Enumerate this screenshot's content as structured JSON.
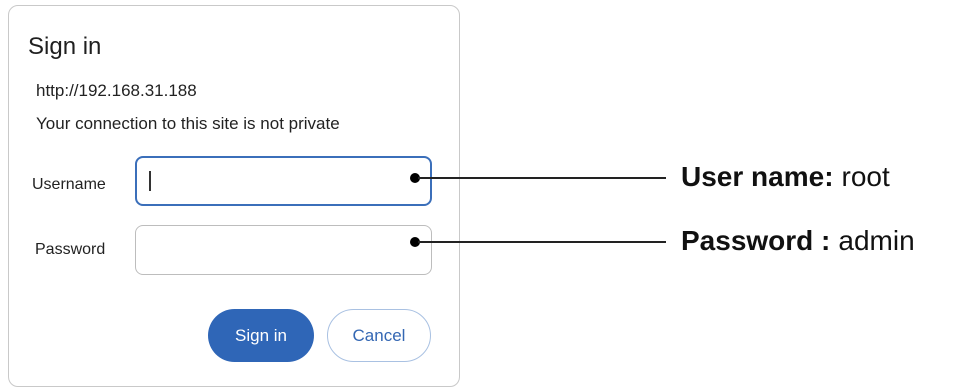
{
  "dialog": {
    "title": "Sign in",
    "url": "http://192.168.31.188",
    "warning": "Your connection to this site is not private",
    "username_label": "Username",
    "password_label": "Password",
    "username_value": "",
    "password_value": "",
    "signin_label": "Sign in",
    "cancel_label": "Cancel"
  },
  "annotations": {
    "username": {
      "label": "User name",
      "separator": ":",
      "value": "root"
    },
    "password": {
      "label": "Password",
      "separator": " :",
      "value": "admin"
    }
  },
  "colors": {
    "primary": "#2f66b7",
    "focus_border": "#3b6fba",
    "cancel_text": "#3467b3",
    "border": "#c9c9c9"
  }
}
